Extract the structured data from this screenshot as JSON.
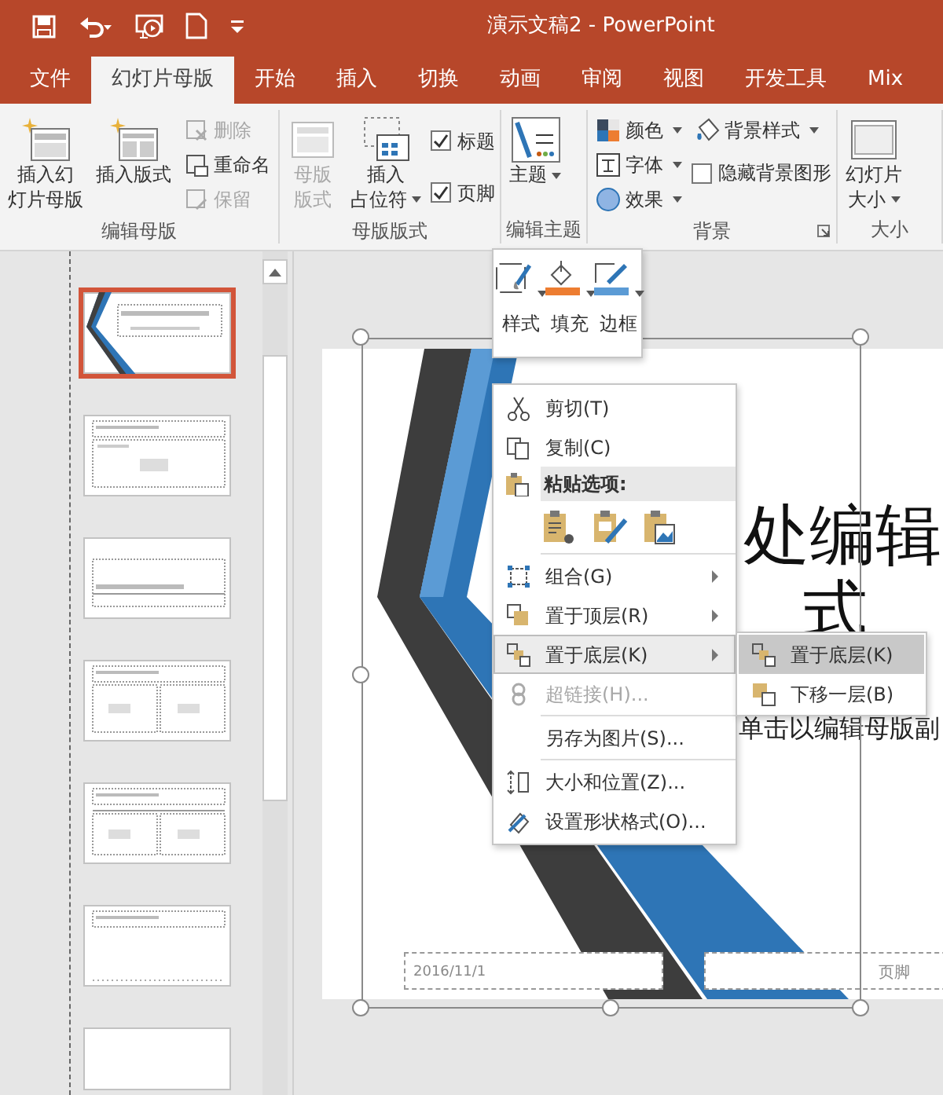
{
  "window": {
    "title": "演示文稿2 - PowerPoint"
  },
  "tabs": [
    {
      "label": "文件",
      "selected": false
    },
    {
      "label": "幻灯片母版",
      "selected": true
    },
    {
      "label": "开始",
      "selected": false
    },
    {
      "label": "插入",
      "selected": false
    },
    {
      "label": "切换",
      "selected": false
    },
    {
      "label": "动画",
      "selected": false
    },
    {
      "label": "审阅",
      "selected": false
    },
    {
      "label": "视图",
      "selected": false
    },
    {
      "label": "开发工具",
      "selected": false
    },
    {
      "label": "Mix",
      "selected": false
    }
  ],
  "ribbon_groups": [
    {
      "label": "编辑母版",
      "columns": [
        [
          {
            "kind": "large",
            "label_lines": [
              "插入幻",
              "灯片母版"
            ],
            "disabled": false
          }
        ],
        [
          {
            "kind": "large",
            "label_lines": [
              "插入版式"
            ],
            "disabled": false
          }
        ],
        [
          {
            "kind": "small",
            "label": "删除",
            "disabled": true
          },
          {
            "kind": "small",
            "label": "重命名",
            "disabled": false
          },
          {
            "kind": "small",
            "label": "保留",
            "disabled": true
          }
        ]
      ]
    },
    {
      "label": "母版版式",
      "columns": [
        [
          {
            "kind": "large",
            "label_lines": [
              "母版",
              "版式"
            ],
            "disabled": true
          }
        ],
        [
          {
            "kind": "large",
            "label_lines": [
              "插入",
              "占位符"
            ],
            "disabled": false,
            "dropdown": true
          }
        ],
        [
          {
            "kind": "checkbox",
            "label": "标题",
            "checked": true
          },
          {
            "kind": "checkbox",
            "label": "页脚",
            "checked": true
          }
        ]
      ]
    },
    {
      "label": "编辑主题",
      "columns": [
        [
          {
            "kind": "large",
            "label_lines": [
              "主题"
            ],
            "disabled": false,
            "dropdown": true
          }
        ]
      ]
    },
    {
      "label": "背景",
      "launcher": true,
      "columns": [
        [
          {
            "kind": "small",
            "label": "颜色",
            "disabled": false,
            "dropdown": true
          },
          {
            "kind": "small",
            "label": "字体",
            "disabled": false,
            "dropdown": true
          },
          {
            "kind": "small",
            "label": "效果",
            "disabled": false,
            "dropdown": true
          }
        ],
        [
          {
            "kind": "small",
            "label": "背景样式",
            "disabled": false,
            "dropdown": true
          },
          {
            "kind": "checkbox",
            "label": "隐藏背景图形",
            "checked": false
          }
        ]
      ]
    },
    {
      "label": "大小",
      "columns": [
        [
          {
            "kind": "large",
            "label_lines": [
              "幻灯片",
              "大小"
            ],
            "disabled": false,
            "dropdown": true
          }
        ]
      ]
    }
  ],
  "thumbnails": [
    {
      "kind": "title",
      "selected": true
    },
    {
      "kind": "title-content",
      "selected": false
    },
    {
      "kind": "section",
      "selected": false
    },
    {
      "kind": "two-content",
      "selected": false
    },
    {
      "kind": "comparison",
      "selected": false
    },
    {
      "kind": "title-only",
      "selected": false
    },
    {
      "kind": "blank",
      "selected": false
    }
  ],
  "slide": {
    "title_lines": [
      "处编辑",
      "式"
    ],
    "subtitle": "单击以编辑母版副",
    "date": "2016/11/1",
    "footer": "页脚"
  },
  "mini_toolbar": [
    {
      "label": "样式",
      "dropdown": true
    },
    {
      "label": "填充",
      "dropdown": true
    },
    {
      "label": "边框",
      "dropdown": true
    }
  ],
  "context_menu": [
    {
      "kind": "item",
      "label": "剪切(T)",
      "selected": false,
      "disabled": false
    },
    {
      "kind": "item",
      "label": "复制(C)",
      "selected": false,
      "disabled": false
    },
    {
      "kind": "header",
      "label": "粘贴选项:"
    },
    {
      "kind": "paste"
    },
    {
      "kind": "separator"
    },
    {
      "kind": "item",
      "label": "组合(G)",
      "selected": false,
      "disabled": false,
      "submenu": true
    },
    {
      "kind": "item",
      "label": "置于顶层(R)",
      "selected": false,
      "disabled": false,
      "submenu": true
    },
    {
      "kind": "item",
      "label": "置于底层(K)",
      "selected": true,
      "disabled": false,
      "submenu": true
    },
    {
      "kind": "item",
      "label": "超链接(H)...",
      "selected": false,
      "disabled": true
    },
    {
      "kind": "separator"
    },
    {
      "kind": "item",
      "label": "另存为图片(S)...",
      "selected": false,
      "disabled": false
    },
    {
      "kind": "separator"
    },
    {
      "kind": "item",
      "label": "大小和位置(Z)...",
      "selected": false,
      "disabled": false
    },
    {
      "kind": "item",
      "label": "设置形状格式(O)...",
      "selected": false,
      "disabled": false
    }
  ],
  "submenu": [
    {
      "label": "置于底层(K)",
      "selected": true
    },
    {
      "label": "下移一层(B)",
      "selected": false
    }
  ]
}
